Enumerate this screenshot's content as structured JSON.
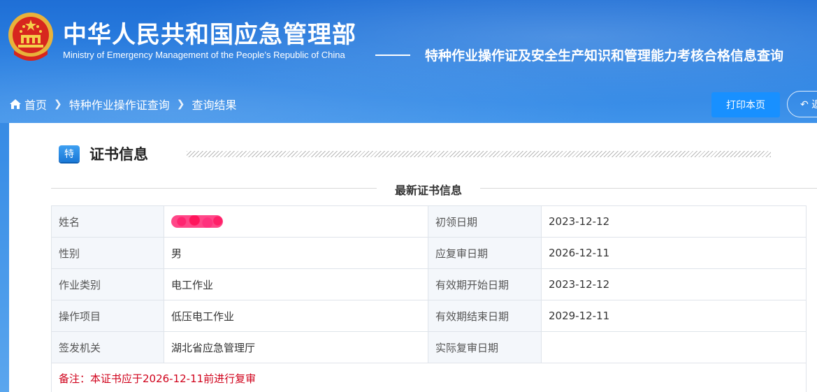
{
  "header": {
    "org_name_cn": "中华人民共和国应急管理部",
    "org_name_en": "Ministry of Emergency Management of the People’s Republic of China",
    "system_title": "特种作业操作证及安全生产知识和管理能力考核合格信息查询"
  },
  "breadcrumb": {
    "home": "首页",
    "item1": "特种作业操作证查询",
    "item2": "查询结果"
  },
  "actions": {
    "print_label": "打印本页",
    "back_label": "返"
  },
  "section": {
    "badge": "特",
    "title": "证书信息",
    "subtitle": "最新证书信息"
  },
  "cert": {
    "rows": [
      {
        "label1": "姓名",
        "value1": "",
        "label2": "初领日期",
        "value2": "2023-12-12"
      },
      {
        "label1": "性别",
        "value1": "男",
        "label2": "应复审日期",
        "value2": "2026-12-11"
      },
      {
        "label1": "作业类别",
        "value1": "电工作业",
        "label2": "有效期开始日期",
        "value2": "2023-12-12"
      },
      {
        "label1": "操作项目",
        "value1": "低压电工作业",
        "label2": "有效期结束日期",
        "value2": "2029-12-11"
      },
      {
        "label1": "签发机关",
        "value1": "湖北省应急管理厅",
        "label2": "实际复审日期",
        "value2": ""
      }
    ],
    "note": "备注：本证书应于2026-12-11前进行复审"
  },
  "colors": {
    "banner": "#2d82e2",
    "button": "#1890ff",
    "note": "#d0021b",
    "label_bg": "#f4f7fb"
  },
  "icons": {
    "home": "home-icon",
    "chevron": "chevron-right-icon",
    "back": "back-arrow-icon",
    "emblem": "national-emblem-icon"
  }
}
